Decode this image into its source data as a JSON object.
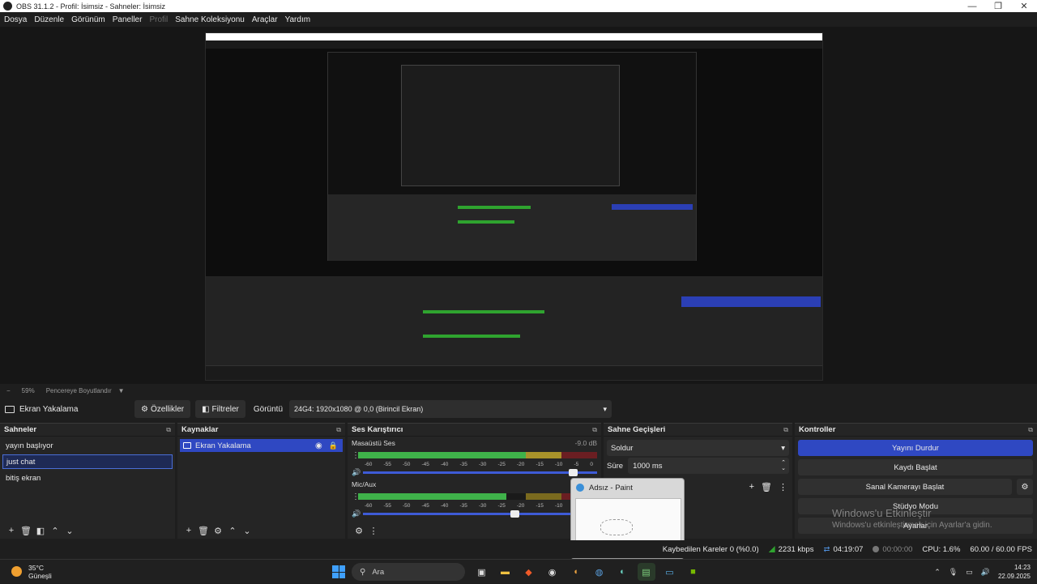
{
  "window": {
    "title": "OBS 31.1.2 - Profil: İsimsiz - Sahneler: İsimsiz"
  },
  "menu": [
    {
      "label": "Dosya",
      "enabled": true
    },
    {
      "label": "Düzenle",
      "enabled": true
    },
    {
      "label": "Görünüm",
      "enabled": true
    },
    {
      "label": "Paneller",
      "enabled": true
    },
    {
      "label": "Profil",
      "enabled": false
    },
    {
      "label": "Sahne Koleksiyonu",
      "enabled": true
    },
    {
      "label": "Araçlar",
      "enabled": true
    },
    {
      "label": "Yardım",
      "enabled": true
    }
  ],
  "zoom": {
    "minus": "−",
    "level": "59%",
    "resize_label": "Pencereye Boyutlandır"
  },
  "source_toolbar": {
    "source_name": "Ekran Yakalama",
    "properties": "Özellikler",
    "filters": "Filtreler",
    "display_label": "Görüntü",
    "display_value": "24G4: 1920x1080 @ 0,0 (Birincil Ekran)"
  },
  "scenes": {
    "title": "Sahneler",
    "items": [
      "yayın başlıyor",
      "just chat",
      "bitiş ekran"
    ],
    "active_index": 1
  },
  "sources": {
    "title": "Kaynaklar",
    "items": [
      "Ekran Yakalama"
    ]
  },
  "mixer": {
    "title": "Ses Karıştırıcı",
    "ticks": [
      "-60",
      "-55",
      "-50",
      "-45",
      "-40",
      "-35",
      "-30",
      "-25",
      "-20",
      "-15",
      "-10",
      "-5",
      "0"
    ],
    "channels": [
      {
        "name": "Masaüstü Ses",
        "db": "-9.0 dB",
        "level": 0.84,
        "volume": 0.9
      },
      {
        "name": "Mic/Aux",
        "db": "",
        "level": 0.62,
        "volume": 0.65
      }
    ]
  },
  "transitions": {
    "title": "Sahne Geçişleri",
    "type": "Soldur",
    "duration_label": "Süre",
    "duration_value": "1000 ms"
  },
  "controls": {
    "title": "Kontroller",
    "stop_stream": "Yayını Durdur",
    "start_record": "Kaydı Başlat",
    "start_vcam": "Sanal Kamerayı Başlat",
    "studio_mode": "Stüdyo Modu",
    "settings": "Ayarlar"
  },
  "watermark": {
    "line1": "Windows'u Etkinleştir",
    "line2": "Windows'u etkinleştirmek için Ayarlar'a gidin."
  },
  "paint_thumb": {
    "title": "Adsız - Paint"
  },
  "status": {
    "dropped": "Kaybedilen Kareler 0 (%0.0)",
    "bitrate": "2231 kbps",
    "stream_time": "04:19:07",
    "record_time": "00:00:00",
    "cpu": "CPU: 1.6%",
    "fps": "60.00 / 60.00 FPS"
  },
  "taskbar": {
    "weather_temp": "35°C",
    "weather_desc": "Güneşli",
    "search": "Ara",
    "time": "14:23",
    "date": "22.09.2025"
  },
  "colors": {
    "accent": "#2f48c2",
    "meter_green": "#3fb24a",
    "panel_bg": "#252525"
  }
}
